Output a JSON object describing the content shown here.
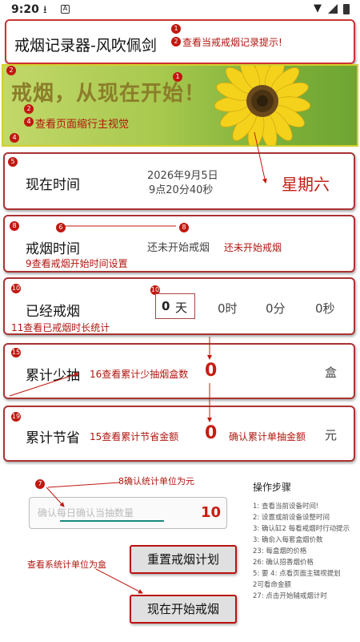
{
  "status_bar": {
    "time": "9:20",
    "icons": [
      "download-icon",
      "a-app-icon",
      "wifi-icon",
      "signal-icon",
      "battery-icon"
    ]
  },
  "app": {
    "title": "戒烟记录器-风吹佩剑"
  },
  "annotations": {
    "title_tip": "查看当戒戒烟记录提示!",
    "badge_1": "1",
    "badge_2": "2",
    "badge_4": "4",
    "banner_tip": "查看页面缩行主视觉",
    "badge_5": "5",
    "badge_6": "6",
    "badge_8": "8",
    "badge_10": "10",
    "badge_11_tip": "11查看已戒烟时长统计",
    "badge_15": "15",
    "badge_16_tip": "16查看累计少抽烟盒数",
    "badge_19": "19",
    "badge_15b_tip": "15查看累计节省金额",
    "confirm_unit_tip": "确认累计单抽金额",
    "not_started_tip": "还未开始戒烟",
    "quit_time_tip": "9查看戒烟开始时间设置",
    "badge_7": "7",
    "unit_tip": "8确认统计单位为元",
    "box_unit_tip": "查看系统计单位为盒"
  },
  "banner": {
    "title": "戒烟，从现在开始！"
  },
  "now_time": {
    "label": "现在时间",
    "date": "2026年9月5日",
    "clock": "9点20分40秒",
    "weekday": "星期六"
  },
  "quit_time": {
    "label": "戒烟时间",
    "value": "还未开始戒烟"
  },
  "duration": {
    "label": "已经戒烟",
    "days_value": "0",
    "days_unit": "天",
    "hours": "0时",
    "minutes": "0分",
    "seconds": "0秒"
  },
  "less_smoked": {
    "label": "累计少抽",
    "value": "0",
    "unit": "盒"
  },
  "saved": {
    "label": "累计节省",
    "value": "0",
    "unit": "元"
  },
  "input": {
    "placeholder": "确认每日确认当抽数量",
    "value": "10"
  },
  "buttons": {
    "reset": "重置戒烟计划",
    "start": "现在开始戒烟"
  },
  "steps": {
    "title": "操作步骤",
    "items": [
      "1: 查看当前设备时间!",
      "2: 设置或前设备设整时间",
      "3: 确认缸2 每看戒烟时行动提示",
      "3: 确俞入每套盒烟价数",
      "23: 每盒烟的价格",
      "26: 确认招香烟价格",
      "5: 要 4: 点看页面主辑视提划",
      "2可看命金额",
      "27: 点击开始辅戒烟计时"
    ]
  },
  "colors": {
    "accent_red": "#c51d13",
    "border_red": "#a33",
    "banner_green": "#a7c84d"
  }
}
